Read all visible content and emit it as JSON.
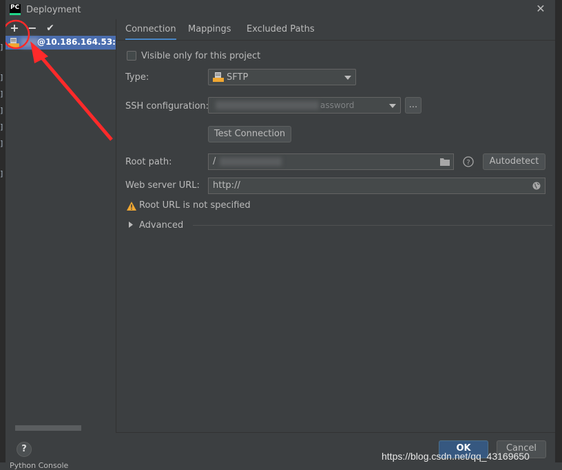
{
  "dialog": {
    "app_icon_text": "PC",
    "title": "Deployment",
    "close_glyph": "✕"
  },
  "toolbar": {
    "add_glyph": "+",
    "remove_glyph": "−",
    "apply_glyph": "✔"
  },
  "servers": [
    {
      "name": "@10.186.164.53:",
      "type_badge": "SFTP",
      "selected": true
    }
  ],
  "tabs": [
    {
      "label": "Connection",
      "active": true
    },
    {
      "label": "Mappings",
      "active": false
    },
    {
      "label": "Excluded Paths",
      "active": false
    }
  ],
  "connection": {
    "visible_only_label": "Visible only for this project",
    "visible_only_checked": false,
    "type_label": "Type:",
    "type_value": "SFTP",
    "ssh_label": "SSH configuration:",
    "ssh_value_suffix": "assword",
    "browse_label": "...",
    "test_label": "Test Connection",
    "root_label": "Root path:",
    "root_value": "/",
    "autodetect_label": "Autodetect",
    "web_label": "Web server URL:",
    "web_value": "http://",
    "warning": "Root URL is not specified",
    "advanced_label": "Advanced"
  },
  "footer": {
    "help_label": "?",
    "ok_label": "OK",
    "cancel_label": "Cancel"
  },
  "ide": {
    "console_label": "Python Console"
  },
  "watermark": "https://blog.csdn.net/qq_43169650",
  "colors": {
    "background": "#3c3f41",
    "selection": "#4b6eaf",
    "accent_tab": "#4a88c7",
    "ok_button": "#365880",
    "warning": "#f0a732",
    "annotation": "#ff2a2a"
  }
}
